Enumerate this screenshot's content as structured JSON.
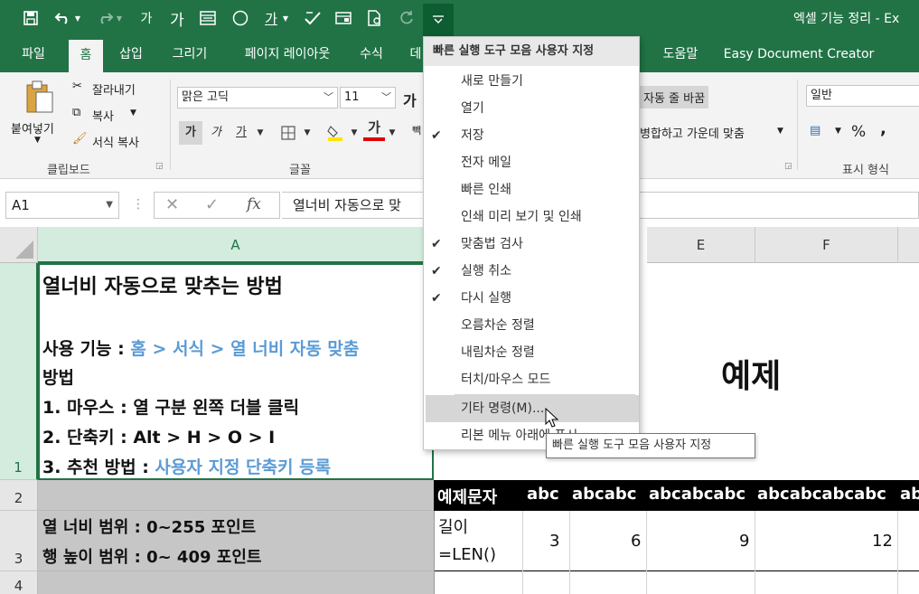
{
  "window": {
    "title": "엑셀 기능 정리 - Ex"
  },
  "quick_access": {
    "icons": [
      "save-icon",
      "undo-icon",
      "redo-icon",
      "font-shrink-icon",
      "font-grow-icon",
      "merge-icon",
      "circle-icon",
      "font-color-icon",
      "spellcheck-icon",
      "print-preview-icon",
      "document-icon",
      "refresh-icon",
      "customize-dropdown-icon"
    ],
    "glyph_ga_small": "가",
    "glyph_ga_large": "가",
    "glyph_ga_underline": "가"
  },
  "tabs": [
    "파일",
    "홈",
    "삽입",
    "그리기",
    "페이지 레이아웃",
    "수식",
    "데",
    "도움말",
    "Easy Document Creator"
  ],
  "active_tab": "홈",
  "ribbon": {
    "clipboard": {
      "paste": "붙여넣기",
      "cut": "잘라내기",
      "copy": "복사",
      "format_painter": "서식 복사",
      "group": "클립보드"
    },
    "font": {
      "name": "맑은 고딕",
      "size": "11",
      "bold": "가",
      "italic": "가",
      "underline": "가",
      "grow": "가",
      "font_color_glyph": "가",
      "group": "글꼴",
      "partial": "빽"
    },
    "alignment": {
      "wrap_text": "자동 줄 바꿈",
      "merge_center": "병합하고 가운데 맞춤"
    },
    "number": {
      "format": "일반",
      "percent": "%",
      "comma": ",",
      "group": "표시 형식"
    }
  },
  "formula_bar": {
    "name_box": "A1",
    "fx": "fx",
    "formula": "열너비 자동으로 맞"
  },
  "menu": {
    "header": "빠른 실행 도구 모음 사용자 지정",
    "items": [
      {
        "label": "새로 만들기",
        "checked": false
      },
      {
        "label": "열기",
        "checked": false
      },
      {
        "label": "저장",
        "checked": true
      },
      {
        "label": "전자 메일",
        "checked": false
      },
      {
        "label": "빠른 인쇄",
        "checked": false
      },
      {
        "label": "인쇄 미리 보기 및 인쇄",
        "checked": false
      },
      {
        "label": "맞춤법 검사",
        "checked": true
      },
      {
        "label": "실행 취소",
        "checked": true
      },
      {
        "label": "다시 실행",
        "checked": true
      },
      {
        "label": "오름차순 정렬",
        "checked": false
      },
      {
        "label": "내림차순 정렬",
        "checked": false
      },
      {
        "label": "터치/마우스 모드",
        "checked": false
      }
    ],
    "more_commands": "기타 명령(M)...",
    "ribbon_below": "리본 메뉴 아래에 표시"
  },
  "tooltip": "빠른 실행 도구 모음 사용자 지정",
  "grid": {
    "columns": [
      "A",
      "E",
      "F"
    ],
    "rows": [
      "1",
      "2",
      "3",
      "4"
    ],
    "a1": {
      "title": "열너비 자동으로 맞추는 방법",
      "usage_prefix": "사용 기능 : ",
      "usage_path": "홈 > 서식 > 열 너비 자동 맞춤",
      "method": "방법",
      "step1": "1. 마우스 : 열 구분 왼쪽 더블 클릭",
      "step2": "2. 단축키 : Alt > H > O > I",
      "step3_prefix": "3. 추천 방법 : ",
      "step3_link": "사용자 지정 단축키 등록"
    },
    "a3": {
      "line1": "열 너비 범위 : 0~255 포인트",
      "line2": "행 높이 범위 : 0~ 409 포인트"
    },
    "example_title": "예제",
    "header_row": [
      "예제문자",
      "abc",
      "abcabc",
      "abcabcabc",
      "abcabcabcabc",
      "ab"
    ],
    "length_label": [
      "길이",
      "=LEN()"
    ],
    "length_values": [
      "3",
      "6",
      "9",
      "12"
    ]
  },
  "colors": {
    "excel_green": "#217346",
    "link_blue": "#5b9bd5"
  }
}
